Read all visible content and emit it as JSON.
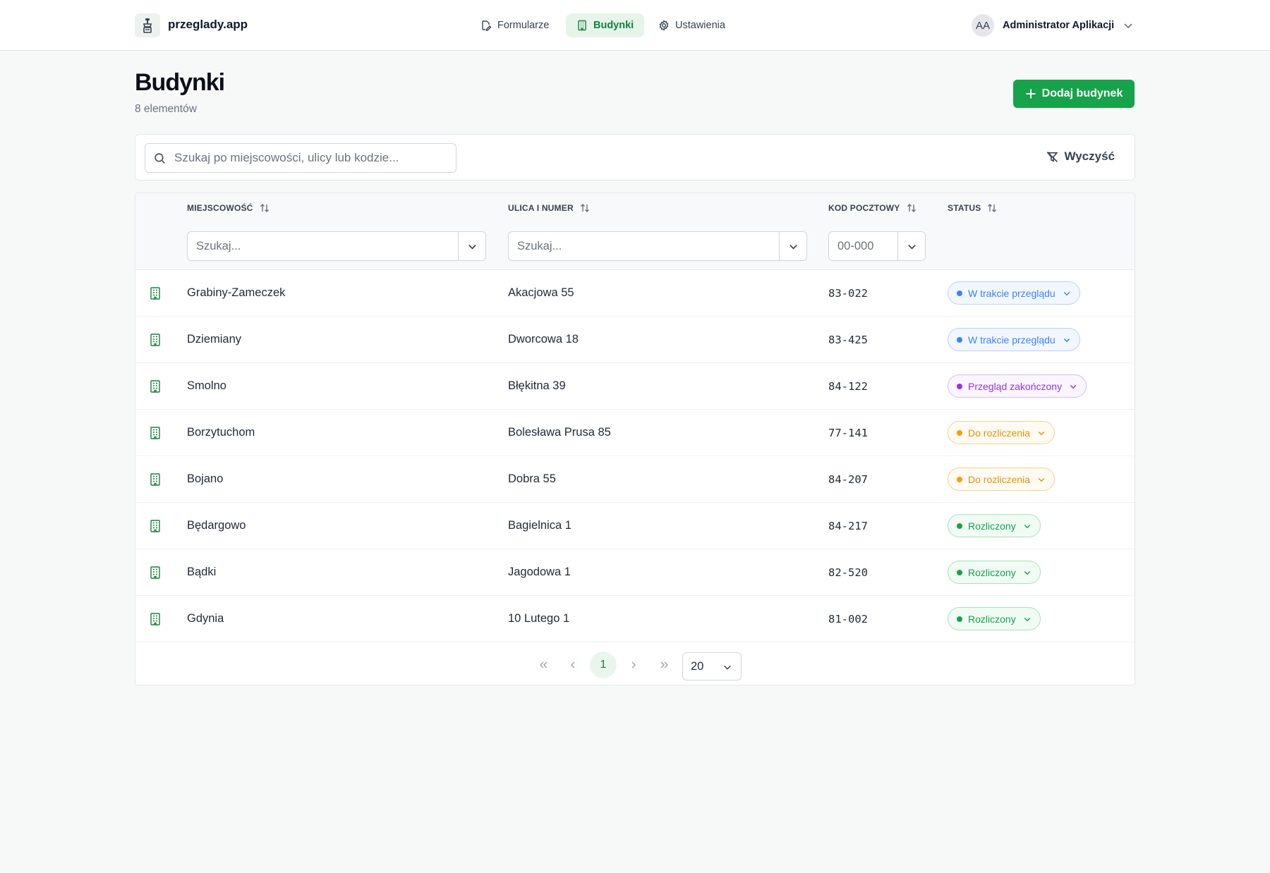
{
  "app": {
    "name": "przeglady.app"
  },
  "nav": {
    "items": [
      {
        "label": "Formularze",
        "icon": "form-icon",
        "active": false
      },
      {
        "label": "Budynki",
        "icon": "building-icon",
        "active": true
      },
      {
        "label": "Ustawienia",
        "icon": "gear-icon",
        "active": false
      }
    ]
  },
  "user": {
    "initials": "AA",
    "name": "Administrator Aplikacji"
  },
  "page": {
    "title": "Budynki",
    "count_label": "8 elementów",
    "add_button": "Dodaj budynek"
  },
  "search": {
    "placeholder": "Szukaj po miejscowości, ulicy lub kodzie...",
    "clear_label": "Wyczyść"
  },
  "table": {
    "columns": [
      "MIEJSCOWOŚĆ",
      "ULICA I NUMER",
      "KOD POCZTOWY",
      "STATUS"
    ],
    "filters": {
      "city_placeholder": "Szukaj...",
      "street_placeholder": "Szukaj...",
      "postal_placeholder": "00-000"
    },
    "rows": [
      {
        "city": "Grabiny-Zameczek",
        "street": "Akacjowa 55",
        "postal": "83-022",
        "status": "W trakcie przeglądu",
        "status_color": "#3b82f6"
      },
      {
        "city": "Dziemiany",
        "street": "Dworcowa 18",
        "postal": "83-425",
        "status": "W trakcie przeglądu",
        "status_color": "#3b82f6"
      },
      {
        "city": "Smolno",
        "street": "Błękitna 39",
        "postal": "84-122",
        "status": "Przegląd zakończony",
        "status_color": "#9333ea"
      },
      {
        "city": "Borzytuchom",
        "street": "Bolesława Prusa 85",
        "postal": "77-141",
        "status": "Do rozliczenia",
        "status_color": "#f59e0b"
      },
      {
        "city": "Bojano",
        "street": "Dobra 55",
        "postal": "84-207",
        "status": "Do rozliczenia",
        "status_color": "#f59e0b"
      },
      {
        "city": "Będargowo",
        "street": "Bagielnica 1",
        "postal": "84-217",
        "status": "Rozliczony",
        "status_color": "#16a34a"
      },
      {
        "city": "Bądki",
        "street": "Jagodowa 1",
        "postal": "82-520",
        "status": "Rozliczony",
        "status_color": "#16a34a"
      },
      {
        "city": "Gdynia",
        "street": "10 Lutego 1",
        "postal": "81-002",
        "status": "Rozliczony",
        "status_color": "#16a34a"
      }
    ]
  },
  "pagination": {
    "current_page": "1",
    "page_size": "20"
  },
  "colors": {
    "accent": "#16a34a",
    "accent_bg": "#e6f4ea"
  }
}
